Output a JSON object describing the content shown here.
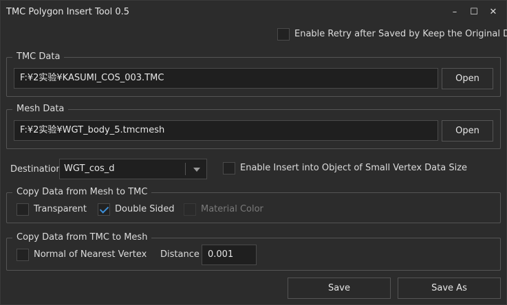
{
  "window": {
    "title": "TMC Polygon Insert Tool 0.5",
    "controls": {
      "minimize": "–",
      "maximize": "☐",
      "close": "✕"
    }
  },
  "retry": {
    "label": "Enable Retry after Saved by Keep the Original Data",
    "checked": false
  },
  "tmc": {
    "legend": "TMC Data",
    "path": "F:¥2实验¥KASUMI_COS_003.TMC",
    "open_label": "Open"
  },
  "mesh": {
    "legend": "Mesh Data",
    "path": "F:¥2实验¥WGT_body_5.tmcmesh",
    "open_label": "Open"
  },
  "destination": {
    "label": "Destination",
    "selected": "WGT_cos_d",
    "small_vertex_label": "Enable Insert into Object of Small Vertex Data Size",
    "small_vertex_checked": false
  },
  "copy_mesh_to_tmc": {
    "legend": "Copy Data from Mesh to TMC",
    "transparent_label": "Transparent",
    "transparent_checked": false,
    "double_sided_label": "Double Sided",
    "double_sided_checked": true,
    "material_color_label": "Material Color",
    "material_color_checked": false,
    "material_color_enabled": false
  },
  "copy_tmc_to_mesh": {
    "legend": "Copy Data from TMC to Mesh",
    "normal_label": "Normal of Nearest Vertex",
    "normal_checked": false,
    "distance_label": "Distance",
    "distance_value": "0.001"
  },
  "footer": {
    "save_label": "Save",
    "save_as_label": "Save As"
  },
  "colors": {
    "background": "#2c2c2c",
    "field": "#1f1f1f",
    "accent": "#3d8fd8",
    "border": "#555555"
  }
}
